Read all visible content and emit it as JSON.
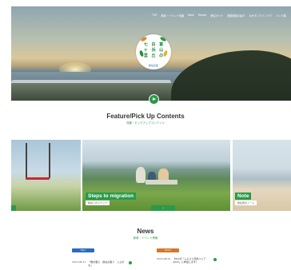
{
  "nav": [
    "TOP",
    "新着・イベント情報",
    "Note",
    "People",
    "移住ガイド",
    "関連施設の紹介",
    "わかすいウインドウ",
    "リンク集"
  ],
  "logo": {
    "chars": [
      "七",
      "白",
      "富",
      "ヶ",
      "浜",
      "山",
      "里",
      "丘",
      "の"
    ],
    "tagline": "移住応援"
  },
  "feature": {
    "title": "Feature/Pick Up Contents",
    "subtitle": "特集・ピックアップコンテンツ",
    "cards": [
      {
        "label": "Steps to migration",
        "sub": "移住へのステップ"
      },
      {
        "label": "Note",
        "sub": "移住者のノート"
      }
    ]
  },
  "news": {
    "title": "News",
    "subtitle": "新着・イベント情報",
    "badges": [
      "Topic",
      "Event"
    ],
    "items": [
      {
        "date": "2023.08.21",
        "text": "「働き暮ら　移住の森２　とぶがな」"
      },
      {
        "date": "2023.08.22",
        "text": "【8/23】「ふるさと回帰フェア2023」に参加します！"
      }
    ]
  }
}
